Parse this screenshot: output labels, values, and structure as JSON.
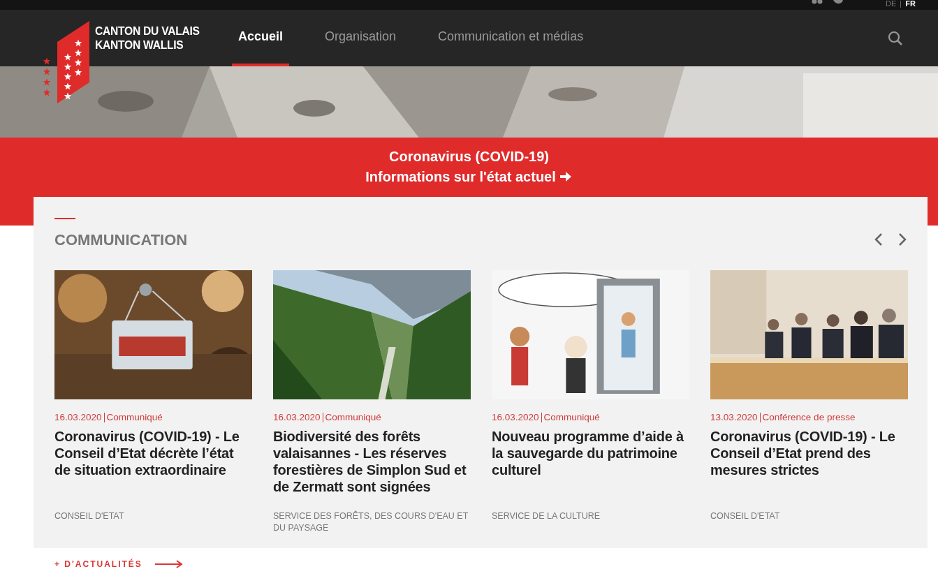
{
  "top_bar": {
    "languages": [
      {
        "label": "DE",
        "selected": false
      },
      {
        "label": "FR",
        "selected": true
      }
    ]
  },
  "header": {
    "logo": {
      "line_1": "CANTON DU VALAIS",
      "line_2": "KANTON WALLIS"
    },
    "nav": [
      {
        "label": "Accueil",
        "selected": true
      },
      {
        "label": "Organisation",
        "selected": false
      },
      {
        "label": "Communication et médias",
        "selected": false
      }
    ]
  },
  "banner": {
    "title": "Coronavirus (COVID-19)",
    "link": "Informations sur l'état actuel"
  },
  "communication": {
    "heading": "COMMUNICATION",
    "cards": [
      {
        "date": "16.03.2020",
        "type": "Communiqué",
        "title": "Coronavirus (COVID-19) - Le Conseil d’Etat décrète l’état de situation extraordinaire",
        "source": "CONSEIL D'ETAT"
      },
      {
        "date": "16.03.2020",
        "type": "Communiqué",
        "title": "Biodiversité des forêts valaisannes - Les réserves forestières de Simplon Sud et de Zermatt sont signées",
        "source": "SERVICE DES FORÊTS, DES COURS D'EAU ET DU PAYSAGE"
      },
      {
        "date": "16.03.2020",
        "type": "Communiqué",
        "title": "Nouveau programme d’aide à la sauvegarde du patrimoine culturel",
        "source": "SERVICE DE LA CULTURE"
      },
      {
        "date": "13.03.2020",
        "type": "Conférence de presse",
        "title": "Coronavirus (COVID-19) - Le Conseil d’Etat prend des mesures strictes",
        "source": "CONSEIL D'ETAT"
      }
    ],
    "more_link": "+ D'ACTUALITÉS"
  }
}
